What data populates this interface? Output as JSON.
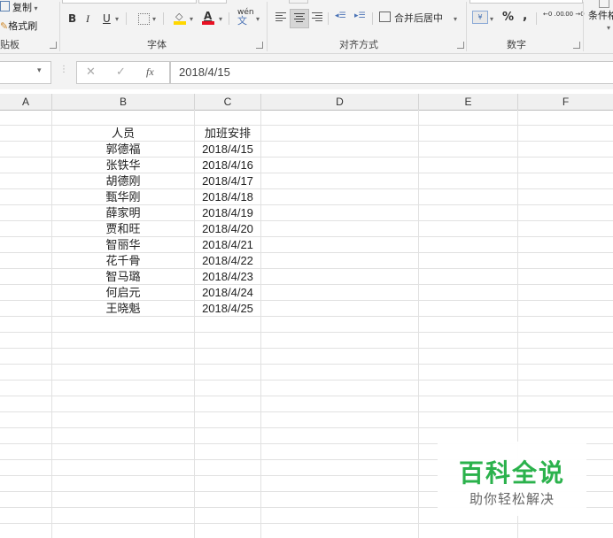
{
  "ribbon": {
    "clipboard": {
      "copy_label": "复制",
      "format_painter_label": "格式刷",
      "group_label": "贴板"
    },
    "font": {
      "bold": "B",
      "italic": "I",
      "underline": "U",
      "font_color_glyph": "A",
      "phonetic_glyph": "wén",
      "group_label": "字体"
    },
    "alignment": {
      "merge_center_label": "合并后居中",
      "group_label": "对齐方式"
    },
    "number": {
      "percent": "%",
      "comma": ",",
      "inc_decimal": "←0 .00",
      "dec_decimal": ".00 →0",
      "group_label": "数字"
    },
    "conditional_format_label": "条件格",
    "colors": {
      "highlight_yellow": "#ffd700",
      "font_red": "#e81123"
    }
  },
  "formula_bar": {
    "cancel_glyph": "✕",
    "enter_glyph": "✓",
    "fx_glyph": "fx",
    "value": "2018/4/15"
  },
  "columns": [
    "A",
    "B",
    "C",
    "D",
    "E",
    "F"
  ],
  "table": {
    "headers": [
      "人员",
      "加班安排"
    ],
    "rows": [
      [
        "郭德福",
        "2018/4/15"
      ],
      [
        "张铁华",
        "2018/4/16"
      ],
      [
        "胡德刚",
        "2018/4/17"
      ],
      [
        "甄华刚",
        "2018/4/18"
      ],
      [
        "薛家明",
        "2018/4/19"
      ],
      [
        "贾和旺",
        "2018/4/20"
      ],
      [
        "智丽华",
        "2018/4/21"
      ],
      [
        "花千骨",
        "2018/4/22"
      ],
      [
        "智马璐",
        "2018/4/23"
      ],
      [
        "何启元",
        "2018/4/24"
      ],
      [
        "王晓魁",
        "2018/4/25"
      ]
    ]
  },
  "watermark": {
    "title": "百科全说",
    "subtitle": "助你轻松解决"
  }
}
